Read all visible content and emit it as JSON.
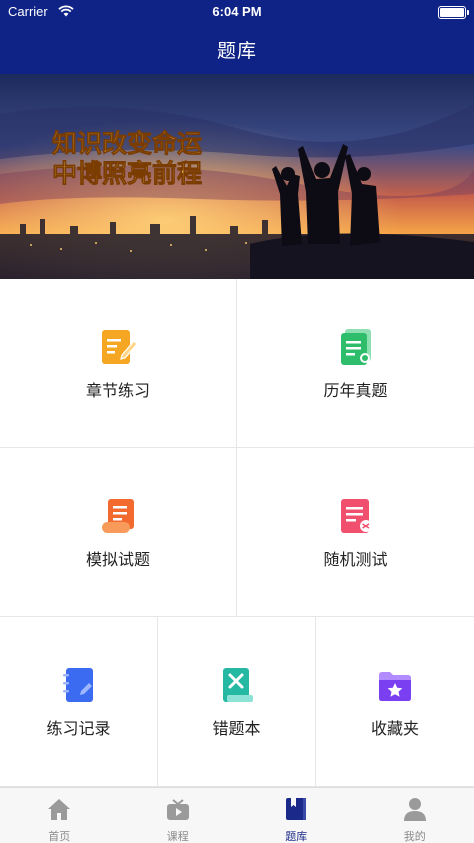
{
  "status_bar": {
    "carrier": "Carrier",
    "time": "6:04 PM"
  },
  "nav": {
    "title": "题库"
  },
  "banner": {
    "line1": "知识改变命运",
    "line2": "中博照亮前程"
  },
  "grid": {
    "items": [
      {
        "label": "章节练习",
        "icon": "pencil-notebook-icon",
        "color": "#f5a623"
      },
      {
        "label": "历年真题",
        "icon": "document-list-icon",
        "color": "#2ebd6b"
      },
      {
        "label": "模拟试题",
        "icon": "scroll-paper-icon",
        "color": "#f26a2e"
      },
      {
        "label": "随机测试",
        "icon": "random-test-icon",
        "color": "#f0506e"
      },
      {
        "label": "练习记录",
        "icon": "notebook-record-icon",
        "color": "#3b6bf0"
      },
      {
        "label": "错题本",
        "icon": "wrong-book-icon",
        "color": "#25b9a4"
      },
      {
        "label": "收藏夹",
        "icon": "star-folder-icon",
        "color": "#7b3ff2"
      }
    ]
  },
  "tabbar": {
    "tabs": [
      {
        "label": "首页",
        "icon": "home-icon"
      },
      {
        "label": "课程",
        "icon": "video-course-icon"
      },
      {
        "label": "题库",
        "icon": "question-bank-icon",
        "active": true
      },
      {
        "label": "我的",
        "icon": "profile-icon"
      }
    ],
    "active_color": "#1b2a8a",
    "inactive_color": "#8a8a8a"
  }
}
